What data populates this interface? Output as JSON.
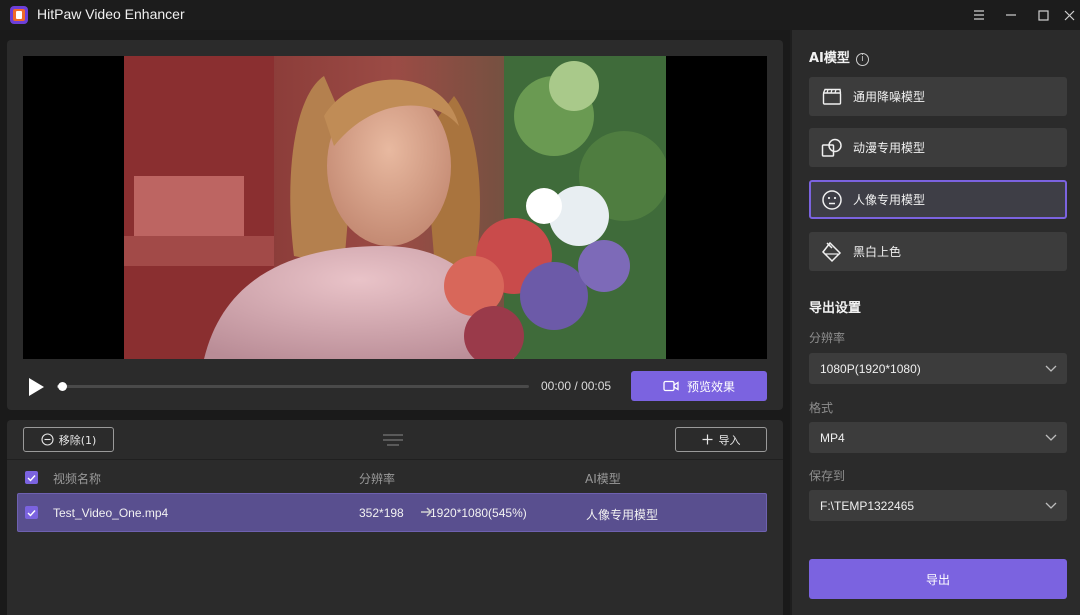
{
  "window": {
    "title": "HitPaw Video Enhancer"
  },
  "preview": {
    "time_current": "00:00",
    "time_separator": "/",
    "time_total": "00:05",
    "progress_fraction": 0.01,
    "preview_button_label": "预览效果"
  },
  "list_toolbar": {
    "remove_label": "移除(1)",
    "import_label": "导入"
  },
  "table": {
    "columns": [
      "视频名称",
      "分辨率",
      "AI模型"
    ],
    "rows": [
      {
        "checked": true,
        "name": "Test_Video_One.mp4",
        "source_resolution": "352*198",
        "target_resolution": "1920*1080(545%)",
        "model": "人像专用模型"
      }
    ]
  },
  "ai_model": {
    "title": "AI模型",
    "options": [
      {
        "label": "通用降噪模型",
        "icon": "film-clapper-icon",
        "selected": false
      },
      {
        "label": "动漫专用模型",
        "icon": "overlapping-shapes-icon",
        "selected": false
      },
      {
        "label": "人像专用模型",
        "icon": "face-icon",
        "selected": true
      },
      {
        "label": "黑白上色",
        "icon": "paint-bucket-icon",
        "selected": false
      }
    ]
  },
  "export_settings": {
    "title": "导出设置",
    "resolution_label": "分辨率",
    "resolution_value": "1080P(1920*1080)",
    "format_label": "格式",
    "format_value": "MP4",
    "save_label": "保存到",
    "save_value": "F:\\TEMP1322465",
    "export_button": "导出"
  },
  "colors": {
    "accent": "#7b63e0",
    "panel": "#2b2b2b",
    "selected_row": "#594f8f"
  }
}
